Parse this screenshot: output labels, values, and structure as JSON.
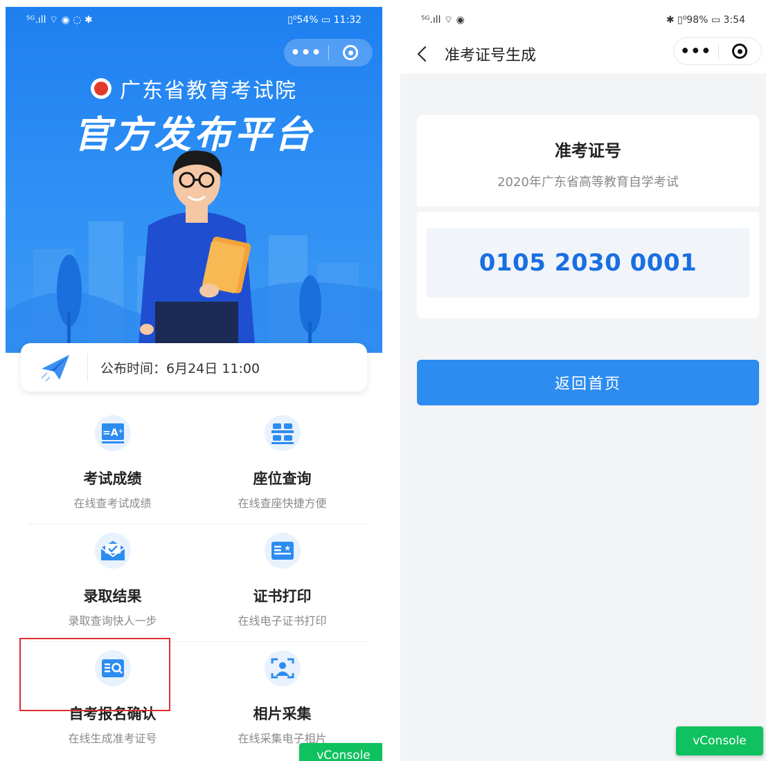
{
  "left_screen": {
    "status_bar": {
      "signal": "⁵ᴳ.ıll ⌔ ◉ ◌ ✱",
      "battery_text": "▯⁰54% ▭ 11:32"
    },
    "banner": {
      "org_name": "广东省教育考试院",
      "title": "官方发布平台"
    },
    "publish": {
      "label": "公布时间：6月24日 11:00"
    },
    "features": [
      {
        "name": "考试成绩",
        "desc": "在线查考试成绩",
        "icon": "score-sheet-icon"
      },
      {
        "name": "座位查询",
        "desc": "在线查座快捷方便",
        "icon": "seat-icon"
      },
      {
        "name": "录取结果",
        "desc": "录取查询快人一步",
        "icon": "envelope-check-icon"
      },
      {
        "name": "证书打印",
        "desc": "在线电子证书打印",
        "icon": "certificate-icon"
      },
      {
        "name": "自考报名确认",
        "desc": "在线生成准考证号",
        "icon": "search-card-icon"
      },
      {
        "name": "相片采集",
        "desc": "在线采集电子相片",
        "icon": "portrait-scan-icon"
      }
    ],
    "vconsole": "vConsole"
  },
  "right_screen": {
    "status_bar": {
      "signal": "⁵ᴳ.ıll ⌔ ◉",
      "battery_text": "✱ ▯⁰98% ▭ 3:54"
    },
    "nav_title": "准考证号生成",
    "card_title": "准考证号",
    "card_subtitle": "2020年广东省高等教育自学考试",
    "ticket_number": "0105 2030 0001",
    "home_button": "返回首页",
    "vconsole": "vConsole"
  },
  "colors": {
    "primary": "#2d8cf0",
    "number": "#1a6fe0",
    "highlight": "#e02d2d",
    "vconsole": "#10c15f"
  }
}
